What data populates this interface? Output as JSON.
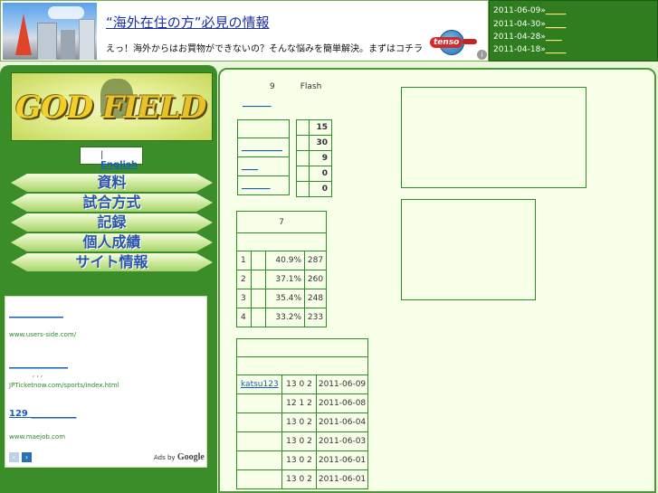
{
  "banner": {
    "title": "“海外在住の方”必見の情報",
    "text": "えっ！海外からはお買物ができないの？そんな悩みを簡単解決。まずはコチラ",
    "logo_word": "tenso",
    "info_glyph": "i"
  },
  "top_dates": [
    {
      "date": "2011-06-09",
      "sep": "»",
      "link": "_____"
    },
    {
      "date": "2011-04-30",
      "sep": "»",
      "link": "_____"
    },
    {
      "date": "2011-04-28",
      "sep": "»",
      "link": "____"
    },
    {
      "date": "2011-04-18",
      "sep": "»",
      "link": "_____"
    }
  ],
  "sidebar": {
    "logo_text_left": "GOD",
    "logo_text_right": "FIELD",
    "lang_separator": "|",
    "lang_link": "English",
    "nav": [
      "資料",
      "試合方式",
      "記録",
      "個人成績",
      "サイト情報"
    ],
    "ads": [
      {
        "link": "____________",
        "desc": "",
        "url": "www.users-side.com/"
      },
      {
        "link": "_____________",
        "desc": ",  ,  ,",
        "url": "JPTicketnow.com/sports/index.html"
      },
      {
        "link": "129 __________",
        "desc": "",
        "url": "www.maejob.com"
      }
    ],
    "ads_prev": "‹",
    "ads_next": "›",
    "ads_by": "Ads by",
    "ads_by_brand": "Google"
  },
  "main": {
    "flash_num": "9",
    "flash_label": "Flash",
    "top_link": "_______",
    "links_table": [
      "__________",
      "____",
      "_______"
    ],
    "counts": [
      "15",
      "30",
      "9",
      "0",
      "0"
    ],
    "ranking": {
      "header": "7",
      "rows": [
        {
          "rank": "1",
          "pct": "40.9%",
          "val": "287"
        },
        {
          "rank": "2",
          "pct": "37.1%",
          "val": "260"
        },
        {
          "rank": "3",
          "pct": "35.4%",
          "val": "248"
        },
        {
          "rank": "4",
          "pct": "33.2%",
          "val": "233"
        }
      ]
    },
    "records": [
      {
        "name": "katsu123",
        "score": "13 0 2",
        "date": "2011-06-09"
      },
      {
        "name": "",
        "score": "12 1 2",
        "date": "2011-06-08"
      },
      {
        "name": "",
        "score": "13 0 2",
        "date": "2011-06-04"
      },
      {
        "name": "",
        "score": "13 0 2",
        "date": "2011-06-03"
      },
      {
        "name": "",
        "score": "13 0 2",
        "date": "2011-06-01"
      },
      {
        "name": "",
        "score": "13 0 2",
        "date": "2011-06-01"
      }
    ]
  }
}
